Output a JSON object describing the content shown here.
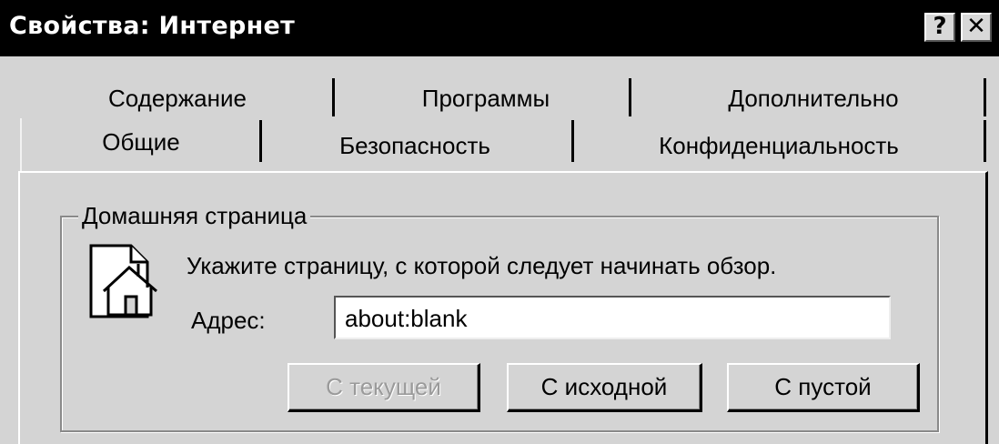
{
  "window": {
    "title": "Свойства: Интернет",
    "help_glyph": "?",
    "close_glyph": "✕"
  },
  "tabs": {
    "back_row": [
      "Содержание",
      "Программы",
      "Дополнительно"
    ],
    "front_row": [
      "Общие",
      "Безопасность",
      "Конфиденциальность"
    ],
    "active": "Общие"
  },
  "home_page": {
    "group_title": "Домашняя страница",
    "icon": "home-page-icon",
    "instruction": "Укажите страницу, с которой следует начинать обзор.",
    "address_label": "Адрес:",
    "address_value": "about:blank",
    "buttons": {
      "current": "С текущей",
      "default": "С исходной",
      "blank": "С пустой"
    },
    "current_disabled": true
  }
}
